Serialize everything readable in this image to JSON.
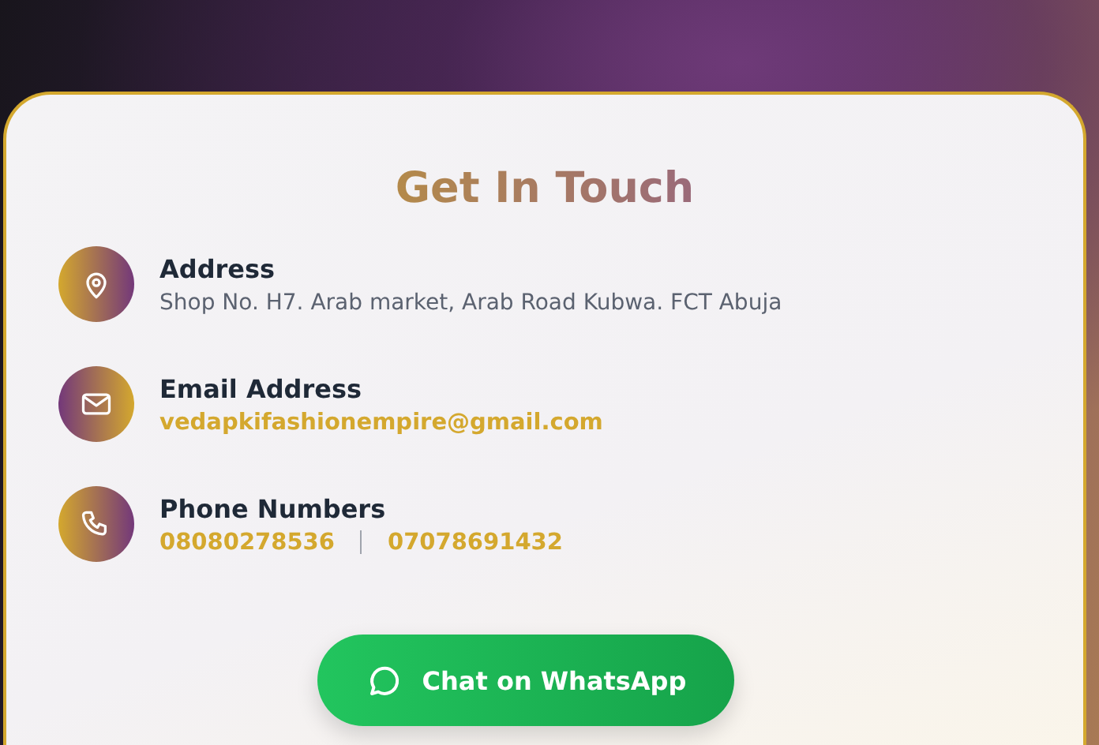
{
  "title": "Get In Touch",
  "contacts": [
    {
      "kind": "location",
      "label": "Address",
      "values": [
        "Shop No. H7. Arab market, Arab Road Kubwa. FCT Abuja"
      ]
    },
    {
      "kind": "email",
      "label": "Email Address",
      "values": [
        "vedapkifashionempire@gmail.com"
      ]
    },
    {
      "kind": "phone",
      "label": "Phone Numbers",
      "values": [
        "08080278536",
        "07078691432"
      ]
    }
  ],
  "button": {
    "label": "Chat on WhatsApp"
  }
}
